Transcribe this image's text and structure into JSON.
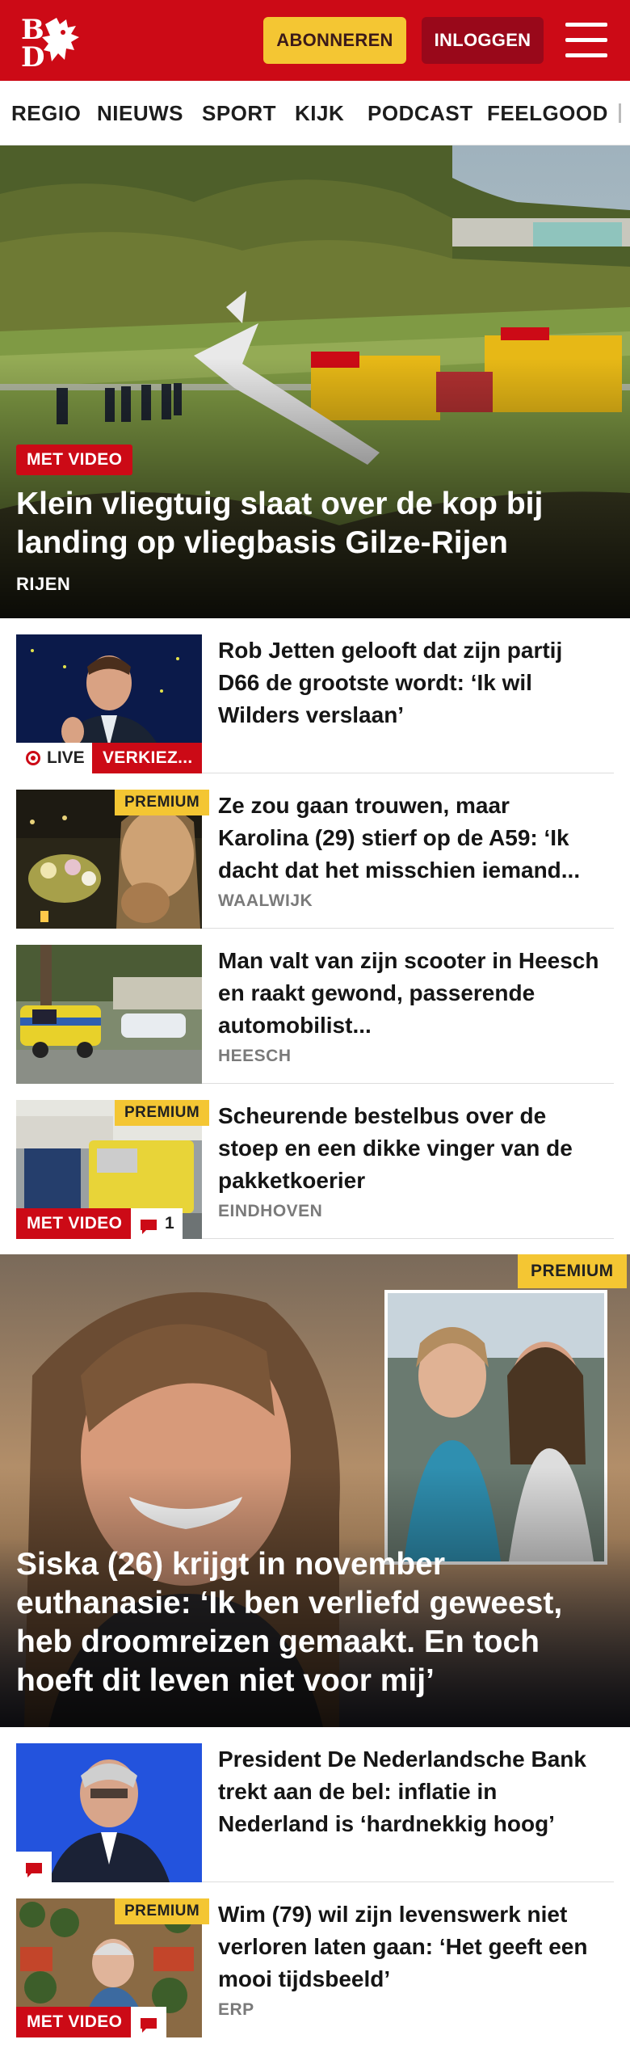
{
  "header": {
    "logo_alt": "BD",
    "subscribe_label": "ABONNEREN",
    "login_label": "INLOGGEN",
    "brand_color": "#cc0a16"
  },
  "nav": {
    "items": [
      "REGIO",
      "NIEUWS",
      "SPORT",
      "KIJK",
      "PODCAST",
      "FEELGOOD"
    ]
  },
  "hero": {
    "badge": "MET VIDEO",
    "title": "Klein vliegtuig slaat over de kop bij landing op vliegbasis Gilze-Rijen",
    "location": "RIJEN"
  },
  "articles": [
    {
      "title": "Rob Jetten gelooft dat zijn partij D66 de grootste wordt: ‘Ik wil Wilders verslaan’",
      "live_label": "LIVE",
      "category_label": "VERKIEZ...",
      "location": ""
    },
    {
      "premium_label": "PREMIUM",
      "title": "Ze zou gaan trouwen, maar Karolina (29) stierf op de A59: ‘Ik dacht dat het misschien iemand...",
      "location": "WAALWIJK"
    },
    {
      "title": "Man valt van zijn scooter in Heesch en raakt gewond, passerende automobilist...",
      "location": "HEESCH"
    },
    {
      "premium_label": "PREMIUM",
      "video_label": "MET VIDEO",
      "comment_count": "1",
      "title": "Scheurende bestelbus over de stoep en een dikke vinger van de pakketkoerier",
      "location": "EINDHOVEN"
    }
  ],
  "feature": {
    "premium_label": "PREMIUM",
    "title": "Siska (26) krijgt in november euthanasie: ‘Ik ben verliefd geweest, heb droomreizen gemaakt. En toch hoeft dit leven niet voor mij’"
  },
  "articles2": [
    {
      "title": "President De Nederlandsche Bank trekt aan de bel: inflatie in Nederland is ‘hardnekkig hoog’",
      "location": ""
    },
    {
      "premium_label": "PREMIUM",
      "video_label": "MET VIDEO",
      "title": "Wim (79) wil zijn levenswerk niet verloren laten gaan: ‘Het geeft een mooi tijdsbeeld’",
      "location": "ERP"
    }
  ],
  "icons": {
    "menu": "hamburger-menu-icon",
    "comment": "comment-bubble-icon",
    "live": "live-record-icon"
  }
}
